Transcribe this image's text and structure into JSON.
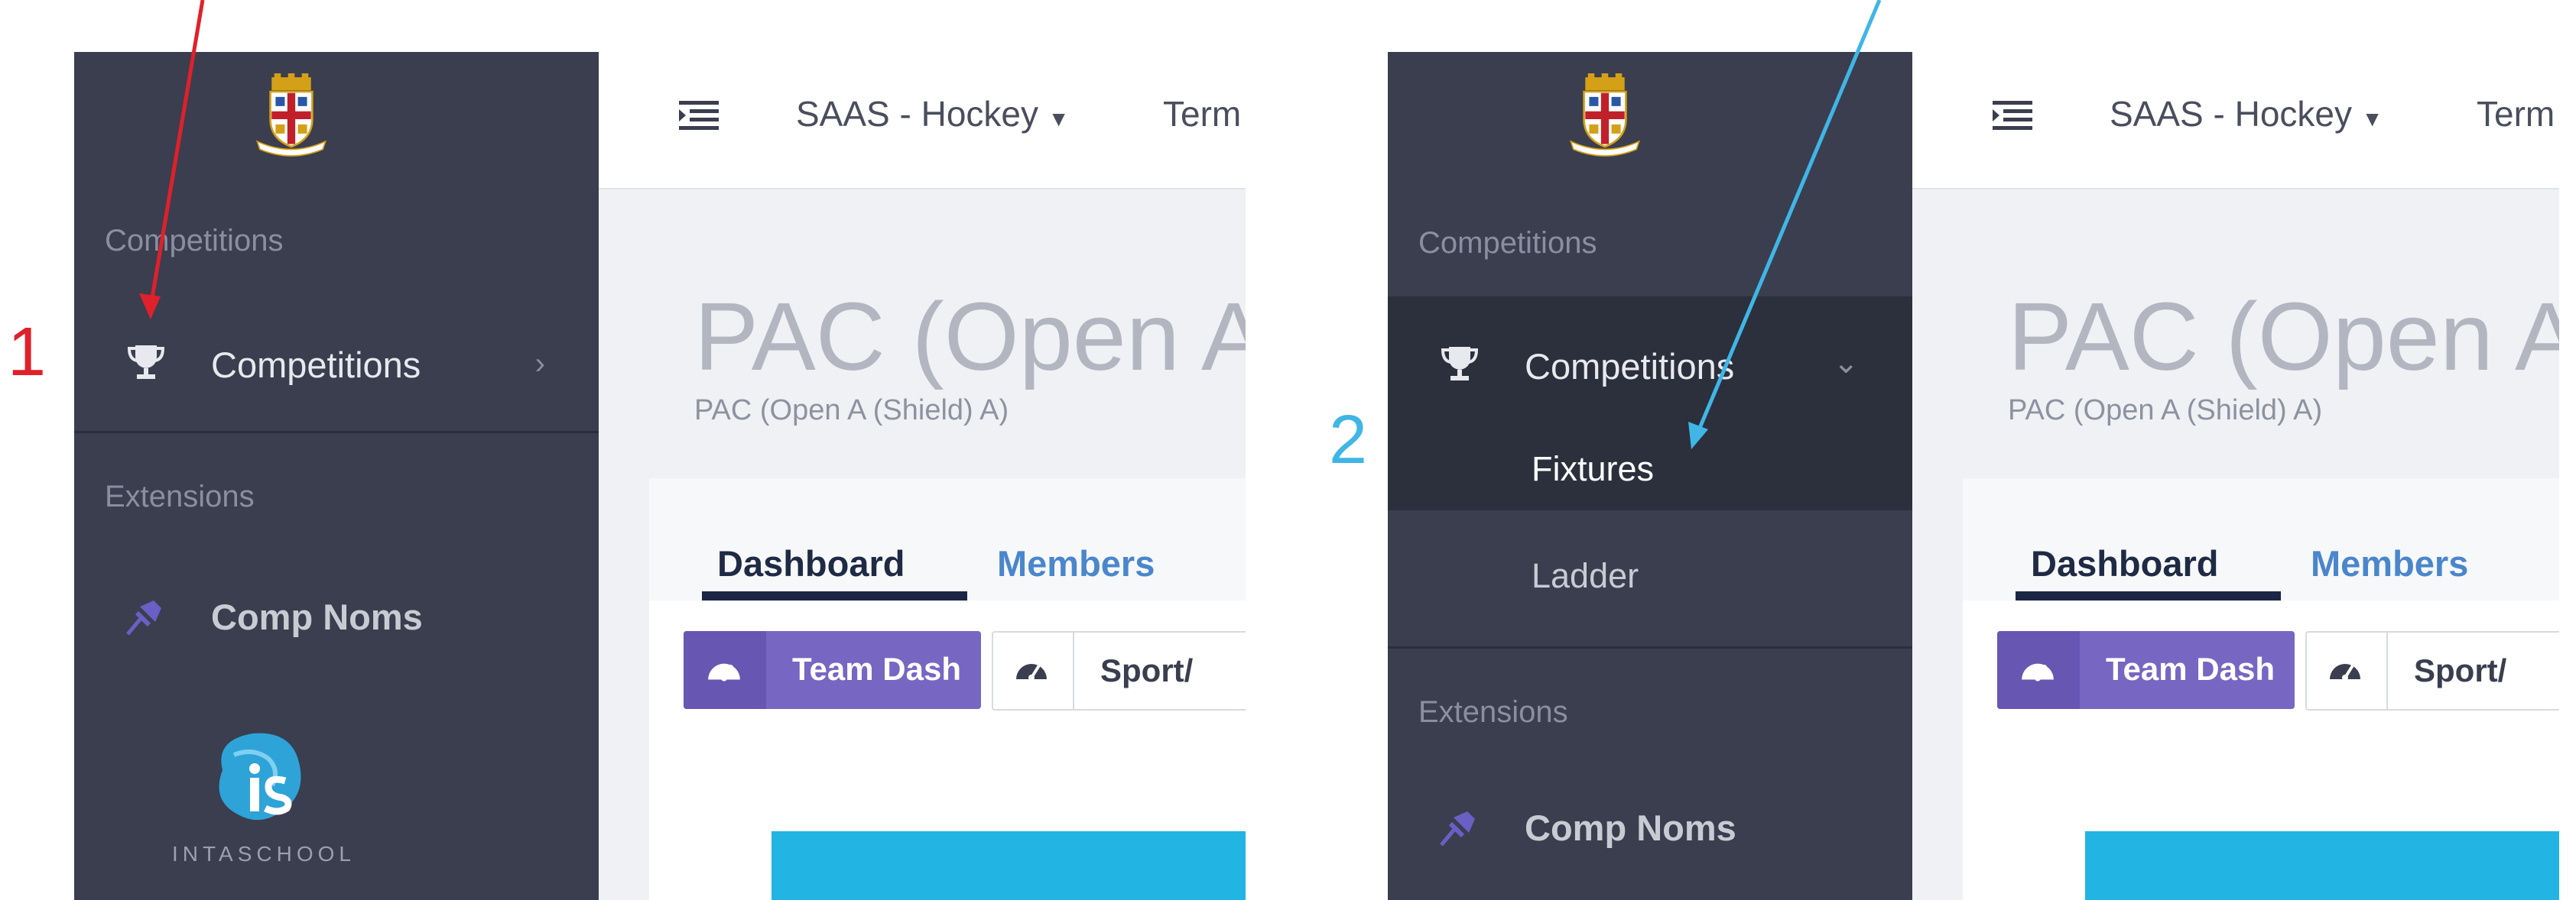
{
  "colors": {
    "sidebar_bg": "#3a3e4f",
    "accent_purple": "#7767c2",
    "link_blue": "#4a86cc",
    "cyan_block": "#22b5e3",
    "annotation_red": "#e0202a",
    "annotation_blue": "#3fb6e6"
  },
  "panels": [
    {
      "step": "1",
      "sidebar": {
        "section_competitions": "Competitions",
        "item_competitions": "Competitions",
        "section_extensions": "Extensions",
        "item_comp_noms": "Comp Noms",
        "logo_text": "INTASCHOOL"
      },
      "topbar": {
        "site_selector": "SAAS - Hockey",
        "term": "Term"
      },
      "page": {
        "title": "PAC (Open A",
        "subtitle": "PAC (Open A (Shield) A)",
        "tabs": [
          "Dashboard",
          "Members"
        ],
        "btn_team_dash": "Team Dash",
        "btn_sport": "Sport/"
      }
    },
    {
      "step": "2",
      "sidebar": {
        "section_competitions": "Competitions",
        "item_competitions": "Competitions",
        "sub_fixtures": "Fixtures",
        "sub_ladder": "Ladder",
        "section_extensions": "Extensions",
        "item_comp_noms": "Comp Noms"
      },
      "topbar": {
        "site_selector": "SAAS - Hockey",
        "term": "Term"
      },
      "page": {
        "title": "PAC (Open A",
        "subtitle": "PAC (Open A (Shield) A)",
        "tabs": [
          "Dashboard",
          "Members"
        ],
        "btn_team_dash": "Team Dash",
        "btn_sport": "Sport/"
      }
    }
  ]
}
